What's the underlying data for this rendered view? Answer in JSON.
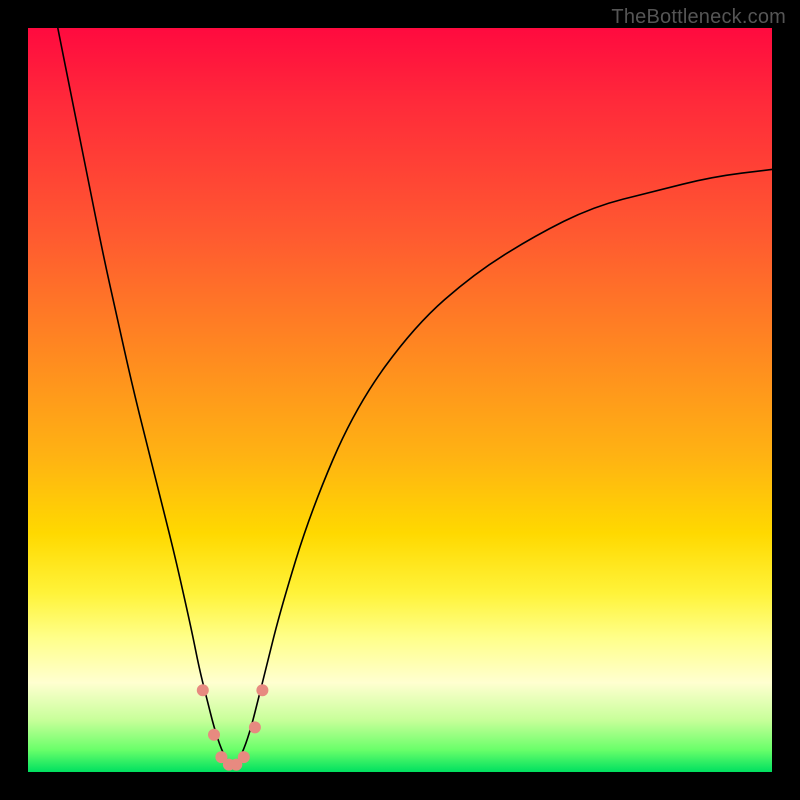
{
  "watermark": "TheBottleneck.com",
  "colors": {
    "background": "#000000",
    "curve": "#000000",
    "marker": "#e78a80",
    "gradient_stops": [
      {
        "pct": 0,
        "hex": "#ff0a3f"
      },
      {
        "pct": 10,
        "hex": "#ff2a3a"
      },
      {
        "pct": 28,
        "hex": "#ff5a30"
      },
      {
        "pct": 44,
        "hex": "#ff8a20"
      },
      {
        "pct": 58,
        "hex": "#ffb412"
      },
      {
        "pct": 68,
        "hex": "#ffd900"
      },
      {
        "pct": 76,
        "hex": "#fff33a"
      },
      {
        "pct": 82,
        "hex": "#ffff8a"
      },
      {
        "pct": 88,
        "hex": "#ffffd0"
      },
      {
        "pct": 93,
        "hex": "#c8ff9a"
      },
      {
        "pct": 97,
        "hex": "#6aff6a"
      },
      {
        "pct": 100,
        "hex": "#00e060"
      }
    ]
  },
  "chart_data": {
    "type": "line",
    "title": "",
    "xlabel": "",
    "ylabel": "",
    "x_range": [
      0,
      100
    ],
    "y_range": [
      0,
      100
    ],
    "note": "Axes unlabeled. x≈component-balance parameter (0–100), y≈bottleneck % (0 good at bottom, 100 bad at top). Curve is a V with minimum near x≈27 y≈0. Values read by pixel position; precision ≈±2.",
    "series": [
      {
        "name": "bottleneck-curve",
        "x": [
          4,
          6,
          8,
          10,
          12,
          14,
          16,
          18,
          20,
          22,
          23,
          24,
          25,
          26,
          27,
          28,
          29,
          30,
          31,
          32,
          34,
          38,
          44,
          52,
          60,
          68,
          76,
          84,
          92,
          100
        ],
        "y": [
          100,
          90,
          80,
          70,
          61,
          52,
          44,
          36,
          28,
          19,
          14,
          10,
          6,
          3,
          1,
          1,
          3,
          6,
          10,
          14,
          22,
          35,
          49,
          60,
          67,
          72,
          76,
          78,
          80,
          81
        ]
      }
    ],
    "markers": {
      "name": "near-trough-points",
      "color": "#e78a80",
      "radius_px": 6,
      "x": [
        23.5,
        25.0,
        26.0,
        27.0,
        28.0,
        29.0,
        30.5,
        31.5
      ],
      "y": [
        11,
        5,
        2,
        1,
        1,
        2,
        6,
        11
      ]
    }
  }
}
